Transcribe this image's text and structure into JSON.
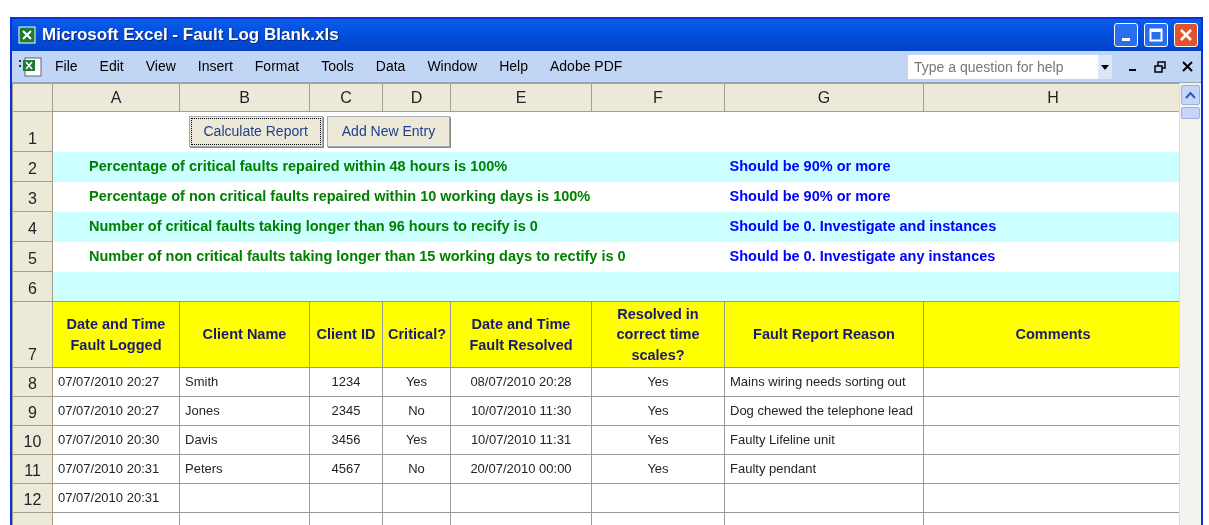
{
  "window": {
    "title": "Microsoft Excel - Fault Log Blank.xls"
  },
  "menu": [
    "File",
    "Edit",
    "View",
    "Insert",
    "Format",
    "Tools",
    "Data",
    "Window",
    "Help",
    "Adobe PDF"
  ],
  "help_box": {
    "placeholder": "Type a question for help"
  },
  "column_letters": [
    "A",
    "B",
    "C",
    "D",
    "E",
    "F",
    "G",
    "H"
  ],
  "row_numbers": [
    "1",
    "2",
    "3",
    "4",
    "5",
    "6",
    "7",
    "8",
    "9",
    "10",
    "11",
    "12"
  ],
  "buttons": [
    {
      "label": "Calculate Report",
      "focused": true
    },
    {
      "label": "Add New Entry",
      "focused": false
    }
  ],
  "summary": [
    {
      "text": "Percentage of critical faults repaired within 48 hours is 100%",
      "target": "Should be 90% or more"
    },
    {
      "text": "Percentage of non critical faults repaired within 10 working days is 100%",
      "target": "Should be 90% or more"
    },
    {
      "text": "Number of critical faults taking longer than 96 hours to recify is 0",
      "target": "Should be 0. Investigate and instances"
    },
    {
      "text": "Number of non critical faults taking longer than 15 working days to rectify is 0",
      "target": "Should be 0. Investigate any instances"
    }
  ],
  "table": {
    "columns": [
      "Date  and Time Fault Logged",
      "Client Name",
      "Client ID",
      "Critical?",
      "Date and Time Fault Resolved",
      "Resolved in correct time scales?",
      "Fault Report Reason",
      "Comments"
    ],
    "rows": [
      {
        "logged": "07/07/2010 20:27",
        "client_name": "Smith",
        "client_id": "1234",
        "critical": "Yes",
        "resolved": "08/07/2010 20:28",
        "in_time": "Yes",
        "reason": "Mains wiring needs sorting out"
      },
      {
        "logged": "07/07/2010 20:27",
        "client_name": "Jones",
        "client_id": "2345",
        "critical": "No",
        "resolved": "10/07/2010 11:30",
        "in_time": "Yes",
        "reason": "Dog chewed the telephone lead"
      },
      {
        "logged": "07/07/2010 20:30",
        "client_name": "Davis",
        "client_id": "3456",
        "critical": "Yes",
        "resolved": "10/07/2010 11:31",
        "in_time": "Yes",
        "reason": "Faulty Lifeline unit"
      },
      {
        "logged": "07/07/2010 20:31",
        "client_name": "Peters",
        "client_id": "4567",
        "critical": "No",
        "resolved": "20/07/2010 00:00",
        "in_time": "Yes",
        "reason": "Faulty pendant"
      },
      {
        "logged": "07/07/2010 20:31"
      }
    ]
  }
}
